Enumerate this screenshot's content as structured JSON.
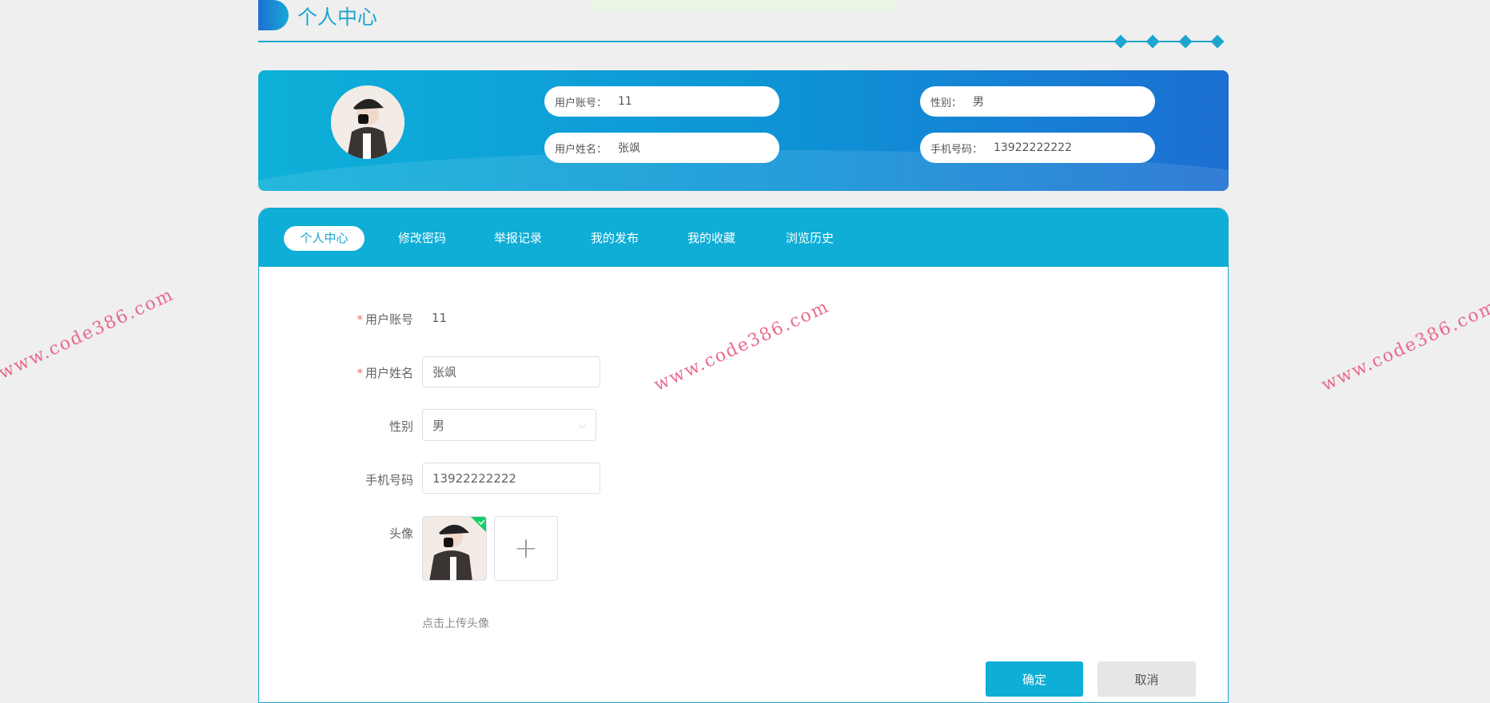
{
  "page_title": "个人中心",
  "banner": {
    "account_label": "用户账号：",
    "account_value": "11",
    "name_label": "用户姓名：",
    "name_value": "张飒",
    "gender_label": "性别：",
    "gender_value": "男",
    "phone_label": "手机号码：",
    "phone_value": "13922222222"
  },
  "tabs": [
    "个人中心",
    "修改密码",
    "举报记录",
    "我的发布",
    "我的收藏",
    "浏览历史"
  ],
  "form": {
    "account_label": "用户账号",
    "account_value": "11",
    "name_label": "用户姓名",
    "name_value": "张飒",
    "gender_label": "性别",
    "gender_value": "男",
    "phone_label": "手机号码",
    "phone_value": "13922222222",
    "avatar_label": "头像",
    "upload_hint": "点击上传头像",
    "required_mark": "*"
  },
  "buttons": {
    "confirm": "确定",
    "cancel": "取消"
  },
  "watermark": "www.code386.com",
  "colors": {
    "accent": "#1ba5cf",
    "tabbar": "#0eaed6",
    "success": "#13ce66"
  }
}
